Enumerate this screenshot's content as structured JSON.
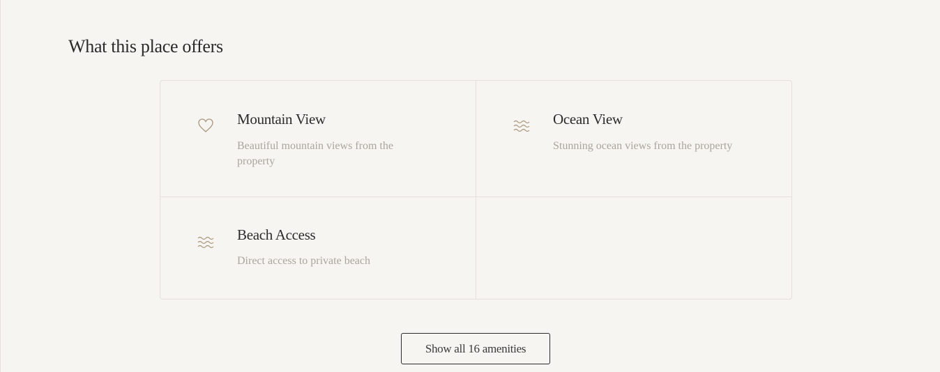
{
  "section": {
    "title": "What this place offers"
  },
  "amenities": [
    {
      "icon": "heart-icon",
      "title": "Mountain View",
      "description": "Beautiful mountain views from the property"
    },
    {
      "icon": "waves-icon",
      "title": "Ocean View",
      "description": "Stunning ocean views from the property"
    },
    {
      "icon": "waves-icon",
      "title": "Beach Access",
      "description": "Direct access to private beach"
    }
  ],
  "show_all_label": "Show all 16 amenities",
  "colors": {
    "accent": "#a8957a",
    "background": "#f7f5f1"
  }
}
